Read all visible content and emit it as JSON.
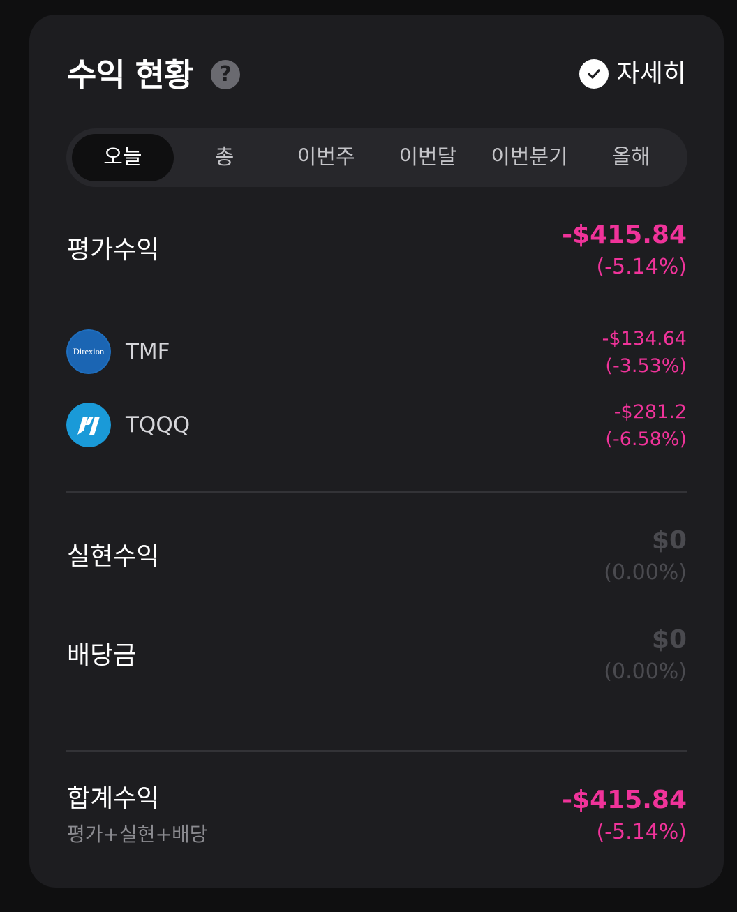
{
  "header": {
    "title": "수익 현황",
    "help_icon": "question-circle-icon",
    "detail_icon": "check-circle-icon",
    "detail_label": "자세히"
  },
  "tabs": [
    {
      "label": "오늘",
      "active": true
    },
    {
      "label": "총",
      "active": false
    },
    {
      "label": "이번주",
      "active": false
    },
    {
      "label": "이번달",
      "active": false
    },
    {
      "label": "이번분기",
      "active": false
    },
    {
      "label": "올해",
      "active": false
    }
  ],
  "unrealized": {
    "label": "평가수익",
    "amount": "-$415.84",
    "percent": "(-5.14%)"
  },
  "stocks": [
    {
      "ticker": "TMF",
      "logo_text": "Direxion",
      "amount": "-$134.64",
      "percent": "(-3.53%)"
    },
    {
      "ticker": "TQQQ",
      "logo_text": "",
      "amount": "-$281.2",
      "percent": "(-6.58%)"
    }
  ],
  "realized": {
    "label": "실현수익",
    "amount": "$0",
    "percent": "(0.00%)"
  },
  "dividend": {
    "label": "배당금",
    "amount": "$0",
    "percent": "(0.00%)"
  },
  "total": {
    "label": "합계수익",
    "sub_label": "평가+실현+배당",
    "amount": "-$415.84",
    "percent": "(-5.14%)"
  },
  "colors": {
    "negative": "#f0339a",
    "muted": "#4a4a4f",
    "card_bg": "#1d1d20",
    "page_bg": "#0f0f10"
  }
}
